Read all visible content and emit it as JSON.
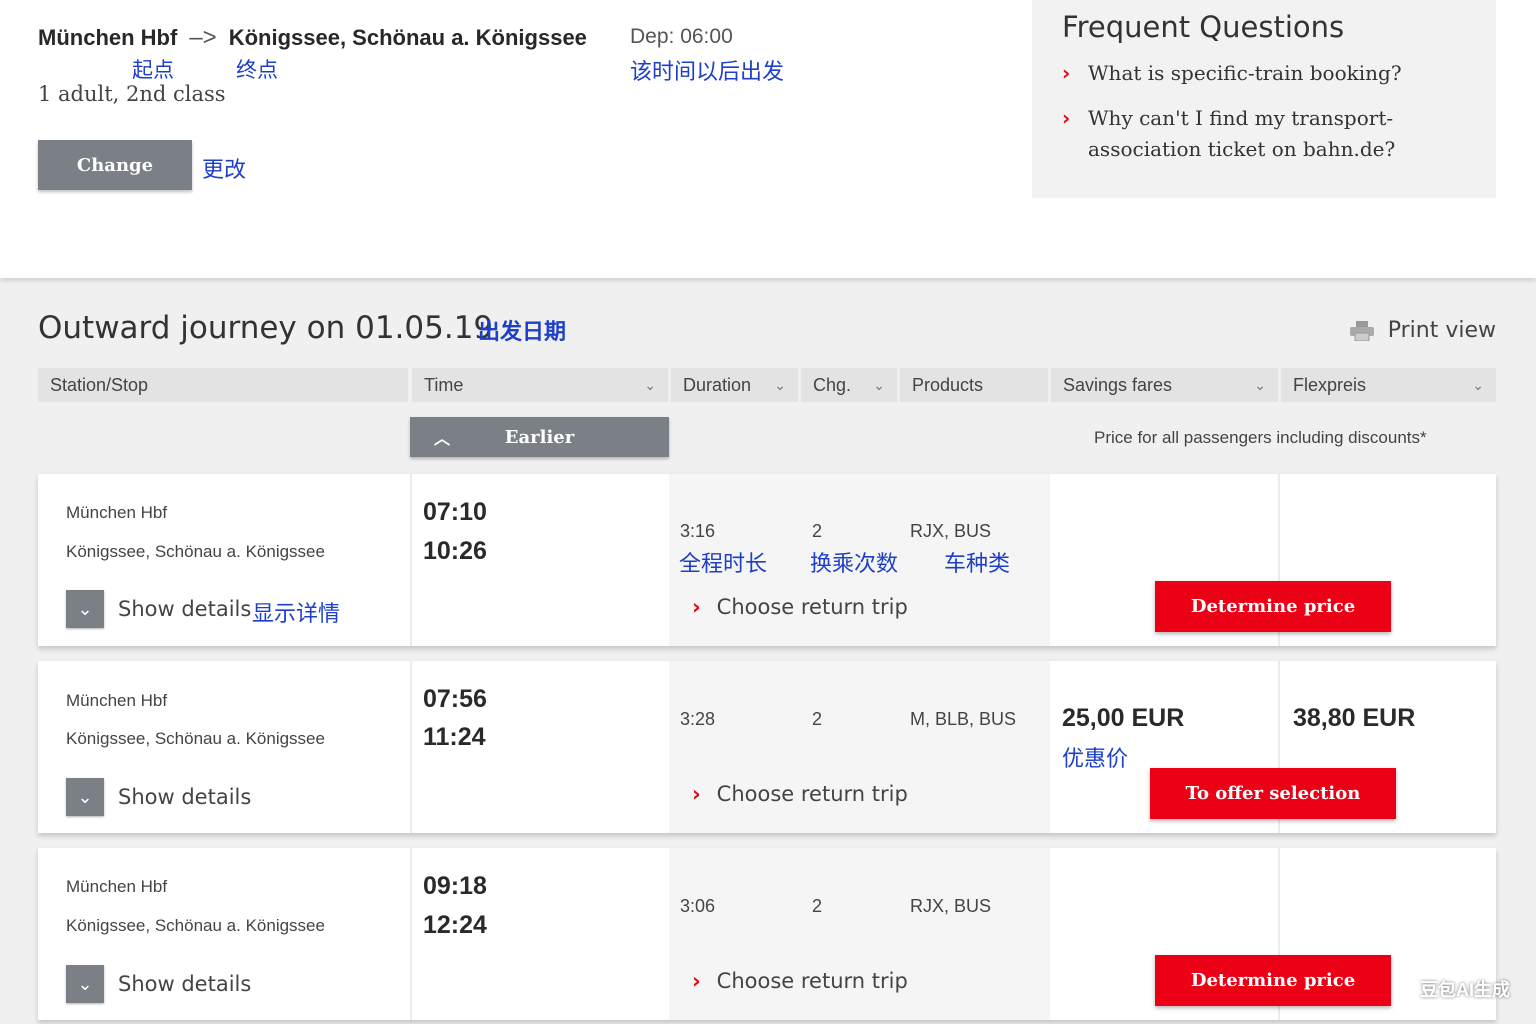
{
  "summary": {
    "from": "München Hbf",
    "arrow": "–>",
    "to": "Königssee, Schönau a. Königssee",
    "anno_start": "起点",
    "anno_end": "终点",
    "passengers": "1 adult, 2nd class",
    "departure": "Dep: 06:00",
    "anno_departure": "该时间以后出发",
    "change_label": "Change",
    "anno_change": "更改"
  },
  "faq": {
    "title": "Frequent Questions",
    "items": [
      {
        "chevron": "›",
        "text": "What is specific-train booking?"
      },
      {
        "chevron": "›",
        "text": "Why can't I find my transport-association ticket on bahn.de?"
      }
    ]
  },
  "journey": {
    "title": "Outward journey on 01.05.19",
    "anno_date": "出发日期",
    "print_label": "Print view",
    "earlier_label": "Earlier",
    "price_note": "Price for all passengers including discounts*",
    "columns": {
      "station": "Station/Stop",
      "time": "Time",
      "duration": "Duration",
      "changes": "Chg.",
      "products": "Products",
      "savings": "Savings fares",
      "flex": "Flexpreis"
    }
  },
  "icons": {
    "dropdown": "⌄",
    "chevron_up": "︿",
    "chevron_down": "⌄",
    "chevron_right": "›",
    "arrow_right": "–>",
    "printer": "printer-icon"
  },
  "results": [
    {
      "from": "München Hbf",
      "to": "Königssee, Schönau a. Königssee",
      "dep": "07:10",
      "arr": "10:26",
      "details_label": "Show details",
      "anno_details": "显示详情",
      "duration": "3:16",
      "changes": "2",
      "products": "RJX, BUS",
      "anno_duration": "全程时长",
      "anno_changes": "换乘次数",
      "anno_products": "车种类",
      "return_label": "Choose return trip",
      "savings_price": "",
      "flex_price": "",
      "anno_savings": "",
      "button_label": "Determine price"
    },
    {
      "from": "München Hbf",
      "to": "Königssee, Schönau a. Königssee",
      "dep": "07:56",
      "arr": "11:24",
      "details_label": "Show details",
      "anno_details": "",
      "duration": "3:28",
      "changes": "2",
      "products": "M, BLB, BUS",
      "anno_duration": "",
      "anno_changes": "",
      "anno_products": "",
      "return_label": "Choose return trip",
      "savings_price": "25,00 EUR",
      "flex_price": "38,80 EUR",
      "anno_savings": "优惠价",
      "button_label": "To offer selection"
    },
    {
      "from": "München Hbf",
      "to": "Königssee, Schönau a. Königssee",
      "dep": "09:18",
      "arr": "12:24",
      "details_label": "Show details",
      "anno_details": "",
      "duration": "3:06",
      "changes": "2",
      "products": "RJX, BUS",
      "anno_duration": "",
      "anno_changes": "",
      "anno_products": "",
      "return_label": "Choose return trip",
      "savings_price": "",
      "flex_price": "",
      "anno_savings": "",
      "button_label": "Determine price"
    }
  ],
  "watermark": "豆包AI生成",
  "colors": {
    "accent_red": "#ec0016",
    "button_gray": "#7b8087",
    "annotation_blue": "#1e40c8"
  }
}
